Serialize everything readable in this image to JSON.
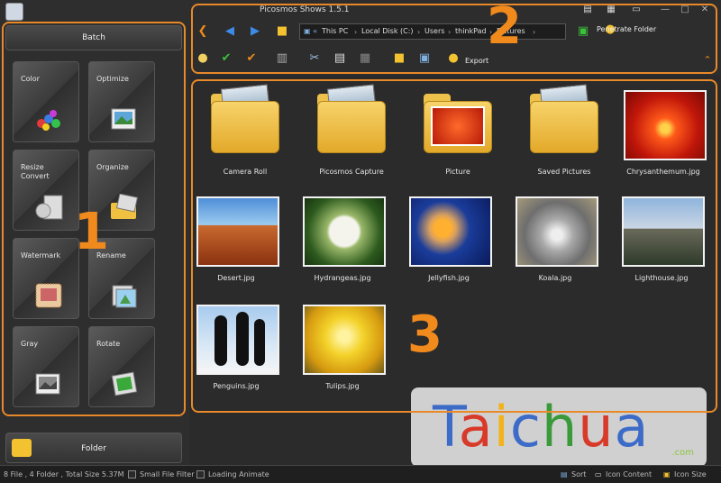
{
  "window": {
    "title": "Picosmos Shows 1.5.1"
  },
  "left_panel": {
    "batch_label": "Batch",
    "tiles": [
      {
        "label": "Color",
        "icon": "color-palette-icon"
      },
      {
        "label": "Optimize",
        "icon": "optimize-icon"
      },
      {
        "label": "Resize\nConvert",
        "icon": "resize-convert-icon"
      },
      {
        "label": "Organize",
        "icon": "organize-icon"
      },
      {
        "label": "Watermark",
        "icon": "watermark-icon"
      },
      {
        "label": "Rename",
        "icon": "rename-icon"
      },
      {
        "label": "Gray",
        "icon": "gray-icon"
      },
      {
        "label": "Rotate",
        "icon": "rotate-icon"
      }
    ],
    "folder_label": "Folder"
  },
  "toolbar": {
    "breadcrumb": [
      "This PC",
      "Local Disk (C:)",
      "Users",
      "thinkPad",
      "Pictures"
    ],
    "penetrate_label": "Penetrate Folder",
    "export_label": "Export"
  },
  "content": {
    "items": [
      {
        "name": "Camera Roll",
        "kind": "folder"
      },
      {
        "name": "Picosmos Capture",
        "kind": "folder"
      },
      {
        "name": "Picture",
        "kind": "folder-image"
      },
      {
        "name": "Saved Pictures",
        "kind": "folder"
      },
      {
        "name": "Chrysanthemum.jpg",
        "kind": "image"
      },
      {
        "name": "Desert.jpg",
        "kind": "image"
      },
      {
        "name": "Hydrangeas.jpg",
        "kind": "image"
      },
      {
        "name": "Jellyfish.jpg",
        "kind": "image"
      },
      {
        "name": "Koala.jpg",
        "kind": "image"
      },
      {
        "name": "Lighthouse.jpg",
        "kind": "image"
      },
      {
        "name": "Penguins.jpg",
        "kind": "image"
      },
      {
        "name": "Tulips.jpg",
        "kind": "image"
      }
    ]
  },
  "status": {
    "summary": "8 File , 4 Folder , Total Size 5.37M",
    "small_file_filter": "Small File Filter",
    "loading_animate": "Loading Animate",
    "sort": "Sort",
    "icon_content": "Icon Content",
    "icon_size": "Icon Size"
  },
  "annotations": {
    "one": "1",
    "two": "2",
    "three": "3"
  },
  "watermark": {
    "text_T": "T",
    "text_a": "a",
    "text_i": "i",
    "text_c": "c",
    "text_h": "h",
    "text_u": "u",
    "text_a2": "a",
    "suffix": ".com"
  },
  "colors": {
    "accent_orange": "#e8892a",
    "folder_yellow": "#f2c230",
    "bg_dark": "#2a2a2a"
  }
}
